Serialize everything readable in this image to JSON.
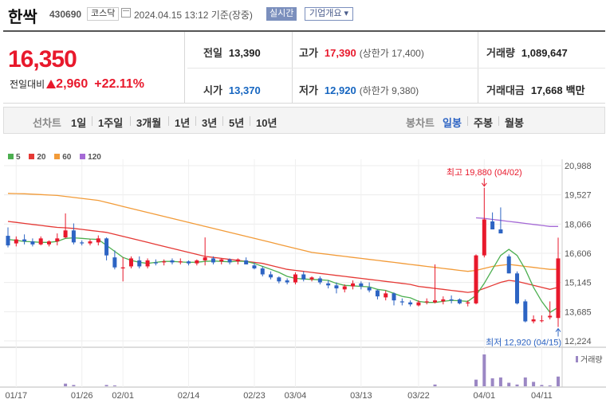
{
  "header": {
    "stock_name": "한싹",
    "stock_code": "430690",
    "market": "코스닥",
    "datetime": "2024.04.15 13:12",
    "basis": "기준(장중)",
    "realtime_label": "실시간",
    "company_info_label": "기업개요 ▾"
  },
  "price": {
    "current": "16,350",
    "change_label": "전일대비",
    "change_value": "2,960",
    "change_pct": "+22.11%",
    "prev_close_label": "전일",
    "prev_close": "13,390",
    "open_label": "시가",
    "open": "13,370",
    "high_label": "고가",
    "high": "17,390",
    "upper_limit": "(상한가 17,400)",
    "low_label": "저가",
    "low": "12,920",
    "lower_limit": "(하한가 9,380)",
    "volume_label": "거래량",
    "volume": "1,089,647",
    "amount_label": "거래대금",
    "amount": "17,668",
    "amount_unit": "백만"
  },
  "period_bar": {
    "line_label": "선차트",
    "line_periods": [
      "1일",
      "1주일",
      "3개월",
      "1년",
      "3년",
      "5년",
      "10년"
    ],
    "candle_label": "봉차트",
    "candle_periods": [
      "일봉",
      "주봉",
      "월봉"
    ],
    "selected_candle": "일봉"
  },
  "colors": {
    "up": "#e8192c",
    "down": "#2d64c3",
    "ma5": "#4caf50",
    "ma20": "#e53935",
    "ma60": "#f29b38",
    "ma120": "#a56ad6",
    "volume": "#9b87c4"
  },
  "chart_data": {
    "type": "candlestick",
    "legend": [
      {
        "name": "5",
        "color": "#4caf50"
      },
      {
        "name": "20",
        "color": "#e53935"
      },
      {
        "name": "60",
        "color": "#f29b38"
      },
      {
        "name": "120",
        "color": "#a56ad6"
      }
    ],
    "y_ticks": [
      "20,988",
      "19,527",
      "18,066",
      "16,606",
      "15,145",
      "13,685",
      "12,224"
    ],
    "ylim": [
      12224,
      20988
    ],
    "x_ticks": [
      "01/17",
      "01/26",
      "02/01",
      "02/14",
      "02/23",
      "03/04",
      "03/13",
      "03/22",
      "04/01",
      "04/11"
    ],
    "high_annotation": "최고 19,880 (04/02)",
    "low_annotation": "최저 12,920 (04/15)",
    "volume_label": "거래량",
    "candles": [
      [
        17480,
        17900,
        16900,
        17000
      ],
      [
        17100,
        17450,
        16950,
        17300
      ],
      [
        17300,
        17550,
        17050,
        17200
      ],
      [
        17200,
        17350,
        16950,
        17050
      ],
      [
        17050,
        17450,
        17000,
        17350
      ],
      [
        17050,
        17250,
        16950,
        17200
      ],
      [
        17200,
        17600,
        17000,
        17350
      ],
      [
        17400,
        18600,
        17350,
        17750
      ],
      [
        17750,
        18100,
        17050,
        17150
      ],
      [
        17150,
        17250,
        17000,
        17100
      ],
      [
        17100,
        17300,
        17000,
        17200
      ],
      [
        17150,
        17500,
        17000,
        17350
      ],
      [
        17350,
        17400,
        16250,
        16500
      ],
      [
        16400,
        16750,
        15800,
        15900
      ],
      [
        15850,
        16400,
        15200,
        15900
      ],
      [
        15950,
        16450,
        15850,
        16350
      ],
      [
        16250,
        16450,
        15850,
        15950
      ],
      [
        15950,
        16350,
        15850,
        16250
      ],
      [
        16150,
        16300,
        16000,
        16100
      ],
      [
        16150,
        16300,
        16000,
        16200
      ],
      [
        16250,
        16350,
        16050,
        16150
      ],
      [
        16150,
        16350,
        16050,
        16200
      ],
      [
        16200,
        16250,
        16000,
        16100
      ],
      [
        16100,
        16300,
        16000,
        16250
      ],
      [
        16250,
        17400,
        16000,
        16400
      ],
      [
        16350,
        16450,
        16050,
        16150
      ],
      [
        16200,
        16350,
        16050,
        16300
      ],
      [
        16300,
        16350,
        16050,
        16150
      ],
      [
        16200,
        16350,
        16050,
        16300
      ],
      [
        16250,
        16400,
        16050,
        16050
      ],
      [
        16000,
        16150,
        15800,
        15850
      ],
      [
        15850,
        15950,
        15450,
        15550
      ],
      [
        15550,
        15700,
        15300,
        15400
      ],
      [
        15400,
        15450,
        15100,
        15200
      ],
      [
        15250,
        15350,
        15050,
        15150
      ],
      [
        15150,
        15650,
        15050,
        15550
      ],
      [
        15550,
        15700,
        15200,
        15300
      ],
      [
        15300,
        15450,
        15200,
        15400
      ],
      [
        15350,
        15450,
        15050,
        15150
      ],
      [
        15100,
        15250,
        14850,
        15000
      ],
      [
        15000,
        15150,
        14600,
        14850
      ],
      [
        14800,
        15050,
        14650,
        14950
      ],
      [
        14950,
        15250,
        14800,
        15100
      ],
      [
        15100,
        15200,
        14800,
        14950
      ],
      [
        14900,
        15150,
        14650,
        14750
      ],
      [
        14750,
        14800,
        14300,
        14450
      ],
      [
        14400,
        14750,
        14250,
        14600
      ],
      [
        14600,
        14650,
        14000,
        14250
      ],
      [
        14200,
        14350,
        14000,
        14150
      ],
      [
        14150,
        14250,
        13950,
        14050
      ],
      [
        14000,
        14250,
        13950,
        14150
      ],
      [
        14150,
        14350,
        14050,
        14200
      ],
      [
        14150,
        16050,
        14100,
        14250
      ],
      [
        14200,
        14450,
        14050,
        14300
      ],
      [
        14300,
        14500,
        14100,
        14250
      ],
      [
        14300,
        14350,
        14050,
        14100
      ],
      [
        14100,
        14250,
        13950,
        14150
      ],
      [
        14100,
        16550,
        14050,
        16500
      ],
      [
        16500,
        19880,
        16400,
        18300
      ],
      [
        18200,
        18650,
        17800,
        17800
      ],
      [
        17800,
        18900,
        17700,
        17600
      ],
      [
        16450,
        16550,
        15600,
        15600
      ],
      [
        15600,
        15700,
        14050,
        14100
      ],
      [
        14200,
        14300,
        13150,
        13200
      ],
      [
        13200,
        13500,
        13100,
        13300
      ],
      [
        13250,
        13500,
        13150,
        13250
      ],
      [
        13400,
        14200,
        13300,
        13480
      ],
      [
        13370,
        17390,
        12920,
        16350
      ]
    ],
    "ma5": [
      17300,
      17250,
      17200,
      17180,
      17150,
      17150,
      17200,
      17350,
      17380,
      17350,
      17320,
      17300,
      17000,
      16700,
      16400,
      16250,
      16150,
      16100,
      16150,
      16200,
      16200,
      16170,
      16150,
      16160,
      16200,
      16220,
      16200,
      16180,
      16210,
      16200,
      16100,
      15950,
      15800,
      15650,
      15450,
      15350,
      15320,
      15300,
      15280,
      15250,
      15100,
      15000,
      14980,
      14950,
      14930,
      14800,
      14750,
      14600,
      14450,
      14380,
      14200,
      14150,
      14150,
      14200,
      14250,
      14230,
      14200,
      14500,
      15100,
      15800,
      16500,
      16800,
      16500,
      15800,
      14900,
      14200,
      13650,
      13900
    ],
    "ma20": [
      18200,
      18150,
      18100,
      18050,
      18000,
      17950,
      17900,
      17880,
      17850,
      17800,
      17750,
      17700,
      17650,
      17550,
      17450,
      17350,
      17250,
      17150,
      17050,
      16950,
      16850,
      16750,
      16650,
      16550,
      16450,
      16400,
      16350,
      16300,
      16250,
      16200,
      16150,
      16100,
      16000,
      15900,
      15800,
      15750,
      15700,
      15650,
      15600,
      15550,
      15500,
      15450,
      15400,
      15350,
      15300,
      15250,
      15200,
      15150,
      15100,
      15050,
      14950,
      14900,
      14850,
      14800,
      14750,
      14700,
      14650,
      14700,
      14850,
      15000,
      15150,
      15250,
      15200,
      15100,
      15000,
      14900,
      14800,
      14900
    ],
    "ma60": [
      19600,
      19590,
      19580,
      19560,
      19540,
      19520,
      19500,
      19450,
      19400,
      19350,
      19300,
      19250,
      19150,
      19050,
      18950,
      18850,
      18750,
      18650,
      18550,
      18450,
      18350,
      18250,
      18150,
      18050,
      17950,
      17850,
      17750,
      17650,
      17550,
      17450,
      17350,
      17250,
      17150,
      17050,
      16950,
      16850,
      16750,
      16650,
      16600,
      16550,
      16500,
      16450,
      16400,
      16350,
      16300,
      16250,
      16200,
      16150,
      16100,
      16050,
      16000,
      15950,
      15900,
      15850,
      15800,
      15750,
      15700,
      15750,
      15850,
      15950,
      16000,
      16050,
      16000,
      15950,
      15900,
      15850,
      15800,
      15800
    ],
    "ma120": [
      null,
      null,
      null,
      null,
      null,
      null,
      null,
      null,
      null,
      null,
      null,
      null,
      null,
      null,
      null,
      null,
      null,
      null,
      null,
      null,
      null,
      null,
      null,
      null,
      null,
      null,
      null,
      null,
      null,
      null,
      null,
      null,
      null,
      null,
      null,
      null,
      null,
      null,
      null,
      null,
      null,
      null,
      null,
      null,
      null,
      null,
      null,
      null,
      null,
      null,
      null,
      null,
      null,
      null,
      null,
      null,
      null,
      18380,
      18350,
      18300,
      18250,
      18200,
      18150,
      18100,
      18050,
      18000,
      17950,
      17950
    ],
    "volumes": [
      0,
      0,
      0,
      0,
      0,
      0,
      0,
      6,
      3,
      0,
      0,
      0,
      3,
      2,
      0,
      0,
      0,
      0,
      0,
      0,
      0,
      0,
      0,
      0,
      0,
      0,
      0,
      0,
      0,
      0,
      0,
      0,
      0,
      0,
      0,
      0,
      0,
      0,
      0,
      0,
      0,
      0,
      0,
      0,
      0,
      0,
      0,
      0,
      0,
      0,
      0,
      0,
      4,
      0,
      0,
      0,
      0,
      15,
      72,
      18,
      20,
      8,
      4,
      20,
      10,
      3,
      2,
      22
    ]
  }
}
